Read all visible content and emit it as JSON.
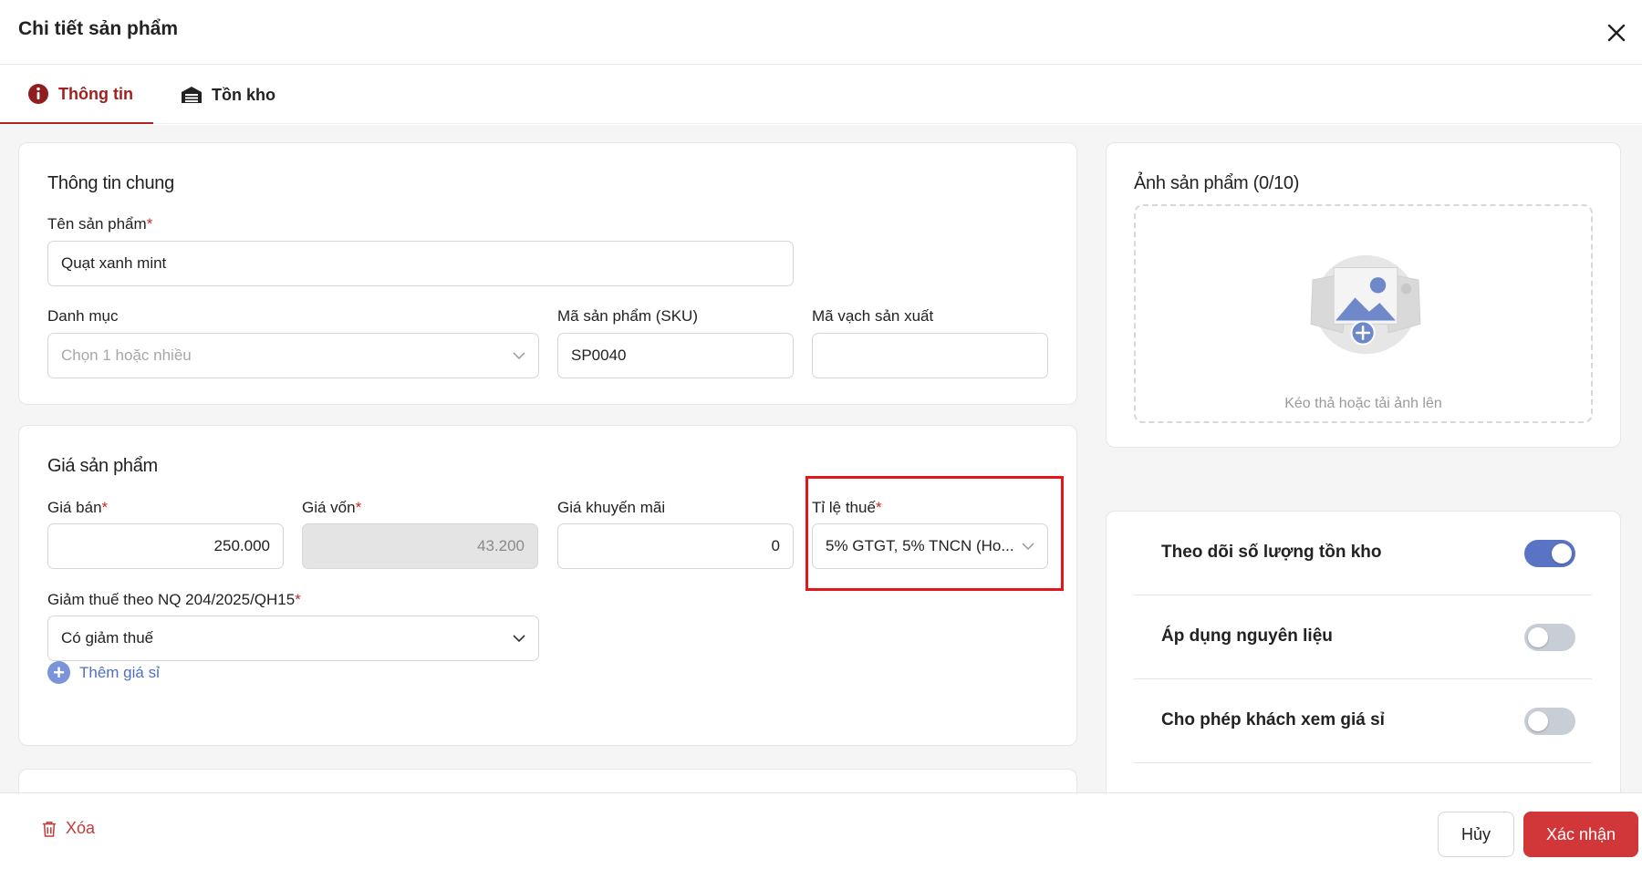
{
  "header": {
    "title": "Chi tiết sản phẩm",
    "close_icon": "close-icon"
  },
  "tabs": [
    {
      "label": "Thông tin",
      "icon": "info-icon",
      "active": true
    },
    {
      "label": "Tồn kho",
      "icon": "warehouse-icon",
      "active": false
    }
  ],
  "general": {
    "title": "Thông tin chung",
    "name_label": "Tên sản phẩm",
    "name_value": "Quạt xanh mint",
    "category_label": "Danh mục",
    "category_placeholder": "Chọn 1 hoặc nhiều",
    "sku_label": "Mã sản phẩm (SKU)",
    "sku_value": "SP0040",
    "barcode_label": "Mã vạch sản xuất",
    "barcode_value": ""
  },
  "pricing": {
    "title": "Giá sản phẩm",
    "sale_price_label": "Giá bán",
    "sale_price_value": "250.000",
    "cost_price_label": "Giá vốn",
    "cost_price_value": "43.200",
    "promo_price_label": "Giá khuyến mãi",
    "promo_price_value": "0",
    "tax_rate_label": "Tỉ lệ thuế",
    "tax_rate_value": "5% GTGT, 5% TNCN (Ho...",
    "tax_reduction_label": "Giảm thuế theo NQ 204/2025/QH15",
    "tax_reduction_value": "Có giảm thuế",
    "add_wholesale_label": "Thêm giá sỉ",
    "required_mark": "*"
  },
  "images": {
    "title": "Ảnh sản phẩm (0/10)",
    "dropzone_hint": "Kéo thả hoặc tải ảnh lên"
  },
  "toggles": [
    {
      "label": "Theo dõi số lượng tồn kho",
      "on": true
    },
    {
      "label": "Áp dụng nguyên liệu",
      "on": false
    },
    {
      "label": "Cho phép khách xem giá sỉ",
      "on": false
    }
  ],
  "footer": {
    "delete_label": "Xóa",
    "cancel_label": "Hủy",
    "confirm_label": "Xác nhận"
  },
  "colors": {
    "brand_red": "#d13638",
    "highlight_red": "#e3161a",
    "toggle_on": "#5a73c4",
    "link_blue": "#4f6fc4"
  }
}
